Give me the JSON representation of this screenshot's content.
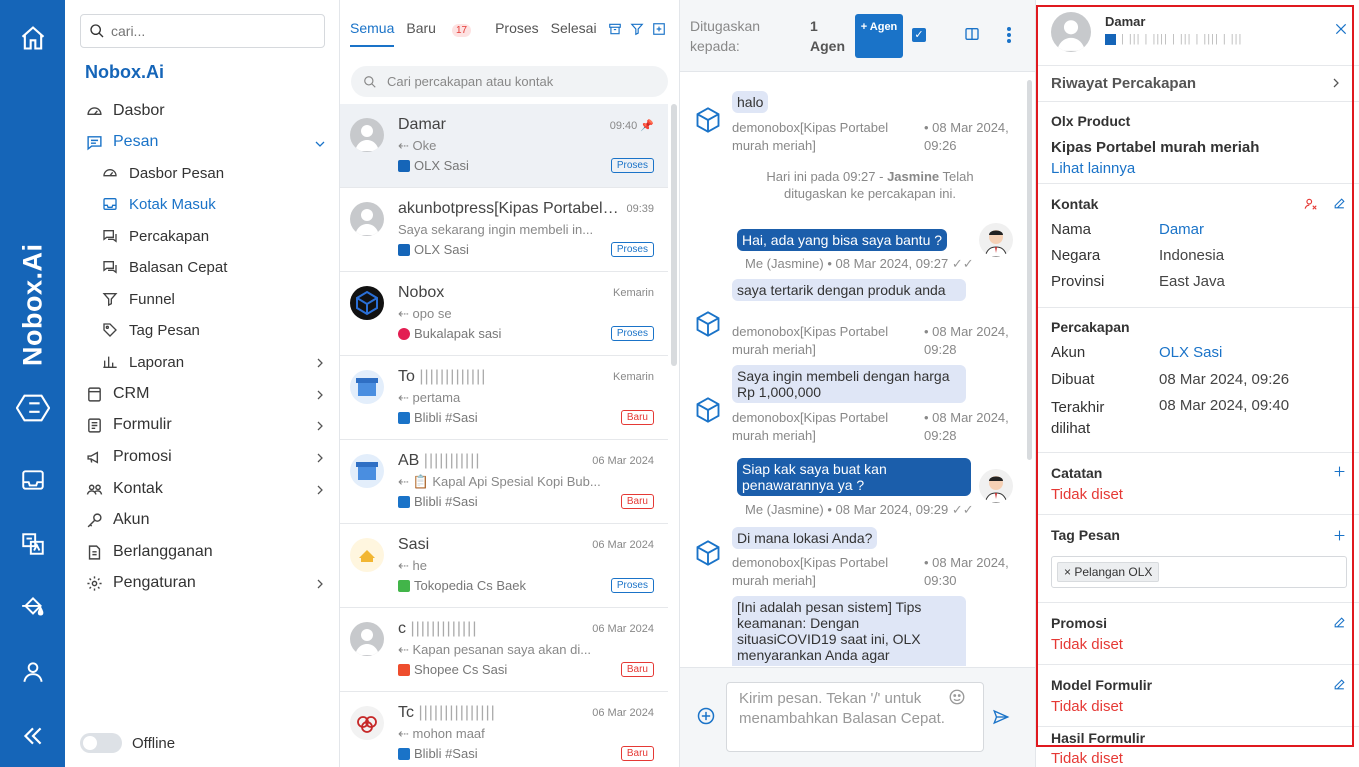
{
  "rail": {
    "brand": "Nobox.Ai"
  },
  "nav": {
    "search_placeholder": "cari...",
    "brand": "Nobox.Ai",
    "items": [
      {
        "label": "Dasbor"
      },
      {
        "label": "Pesan"
      },
      {
        "label": "Dasbor Pesan"
      },
      {
        "label": "Kotak Masuk"
      },
      {
        "label": "Percakapan"
      },
      {
        "label": "Balasan Cepat"
      },
      {
        "label": "Funnel"
      },
      {
        "label": "Tag Pesan"
      },
      {
        "label": "Laporan"
      },
      {
        "label": "CRM"
      },
      {
        "label": "Formulir"
      },
      {
        "label": "Promosi"
      },
      {
        "label": "Kontak"
      },
      {
        "label": "Akun"
      },
      {
        "label": "Berlangganan"
      },
      {
        "label": "Pengaturan"
      }
    ],
    "status": "Offline"
  },
  "list": {
    "tabs": [
      {
        "label": "Semua"
      },
      {
        "label": "Baru",
        "count": "17"
      },
      {
        "label": "Proses"
      },
      {
        "label": "Selesai"
      }
    ],
    "search_placeholder": "Cari percakapan atau kontak",
    "conversations": [
      {
        "name": "Damar",
        "time": "09:40",
        "msg": "Oke",
        "channel": "OLX Sasi",
        "badge": "Proses"
      },
      {
        "name": "akunbotpress[Kipas Portabel murah meriah]",
        "time": "09:39",
        "msg": "Saya sekarang ingin membeli in...",
        "channel": "OLX Sasi",
        "badge": "Proses"
      },
      {
        "name": "Nobox",
        "time": "Kemarin",
        "msg": "opo se",
        "channel": "Bukalapak sasi",
        "badge": "Proses"
      },
      {
        "name": "To",
        "time": "Kemarin",
        "msg": "pertama",
        "channel": "Blibli #Sasi",
        "badge": "Baru"
      },
      {
        "name": "AB",
        "time": "06 Mar 2024",
        "msg": "📋 Kapal Api Spesial Kopi Bub...",
        "channel": "Blibli #Sasi",
        "badge": "Baru"
      },
      {
        "name": "Sasi",
        "time": "06 Mar 2024",
        "msg": "he",
        "channel": "Tokopedia Cs Baek",
        "badge": "Proses"
      },
      {
        "name": "c",
        "time": "06 Mar 2024",
        "msg": "Kapan pesanan saya akan di...",
        "channel": "Shopee Cs Sasi",
        "badge": "Baru"
      },
      {
        "name": "Tc",
        "time": "06 Mar 2024",
        "msg": "mohon maaf",
        "channel": "Blibli #Sasi",
        "badge": "Baru"
      }
    ]
  },
  "chat": {
    "assigned_label": "Ditugaskan kepada:",
    "agent_count": "1 Agen",
    "add_agent": "+ Agen",
    "messages": [
      {
        "text": "halo",
        "meta": "demonobox[Kipas Portabel murah meriah]",
        "time": "08 Mar 2024, 09:26"
      },
      {
        "system_prefix": "Hari ini pada 09:27 - ",
        "system_name": "Jasmine",
        "system_suffix": " Telah ditugaskan ke percakapan ini."
      },
      {
        "text": "Hai, ada yang bisa saya bantu ?",
        "meta": "Me (Jasmine) • 08 Mar 2024, 09:27"
      },
      {
        "text": "saya tertarik dengan produk anda",
        "meta": "demonobox[Kipas Portabel murah meriah]",
        "time": "08 Mar 2024, 09:28"
      },
      {
        "text": "Saya ingin membeli dengan harga Rp 1,000,000",
        "meta": "demonobox[Kipas Portabel murah meriah]",
        "time": "08 Mar 2024, 09:28"
      },
      {
        "text": "Siap kak saya buat kan penawarannya ya ?",
        "meta": "Me (Jasmine) • 08 Mar 2024, 09:29"
      },
      {
        "text": "Di mana lokasi Anda?",
        "meta": "demonobox[Kipas Portabel murah meriah]",
        "time": "08 Mar 2024, 09:30"
      },
      {
        "text": "[Ini adalah pesan sistem] Tips keamanan: Dengan situasiCOVID19 saat ini, OLX menyarankan Anda agar"
      }
    ],
    "compose_placeholder": "Kirim pesan. Tekan '/' untuk menambahkan Balasan Cepat."
  },
  "detail": {
    "name": "Damar",
    "history": "Riwayat Percakapan",
    "product_title": "Olx Product",
    "product_name": "Kipas Portabel murah meriah",
    "product_more": "Lihat lainnya",
    "contact_title": "Kontak",
    "contact": [
      {
        "label": "Nama",
        "value": "Damar"
      },
      {
        "label": "Negara",
        "value": "Indonesia"
      },
      {
        "label": "Provinsi",
        "value": "East Java"
      }
    ],
    "conv_title": "Percakapan",
    "conv": [
      {
        "label": "Akun",
        "value": "OLX Sasi"
      },
      {
        "label": "Dibuat",
        "value": "08 Mar 2024, 09:26"
      },
      {
        "label": "Terakhir dilihat",
        "value": "08 Mar 2024, 09:40"
      }
    ],
    "notes_title": "Catatan",
    "unset": "Tidak diset",
    "tags_title": "Tag Pesan",
    "tag": "Pelangan OLX",
    "promo_title": "Promosi",
    "form_model_title": "Model Formulir",
    "form_result_title": "Hasil Formulir"
  },
  "colors": {
    "brand": "#1565b8",
    "accent": "#1a73c8",
    "out_bubble": "#1b5eab",
    "in_bubble": "#dfe6f6",
    "danger": "#e53935",
    "highlight_frame": "#e0191f"
  }
}
